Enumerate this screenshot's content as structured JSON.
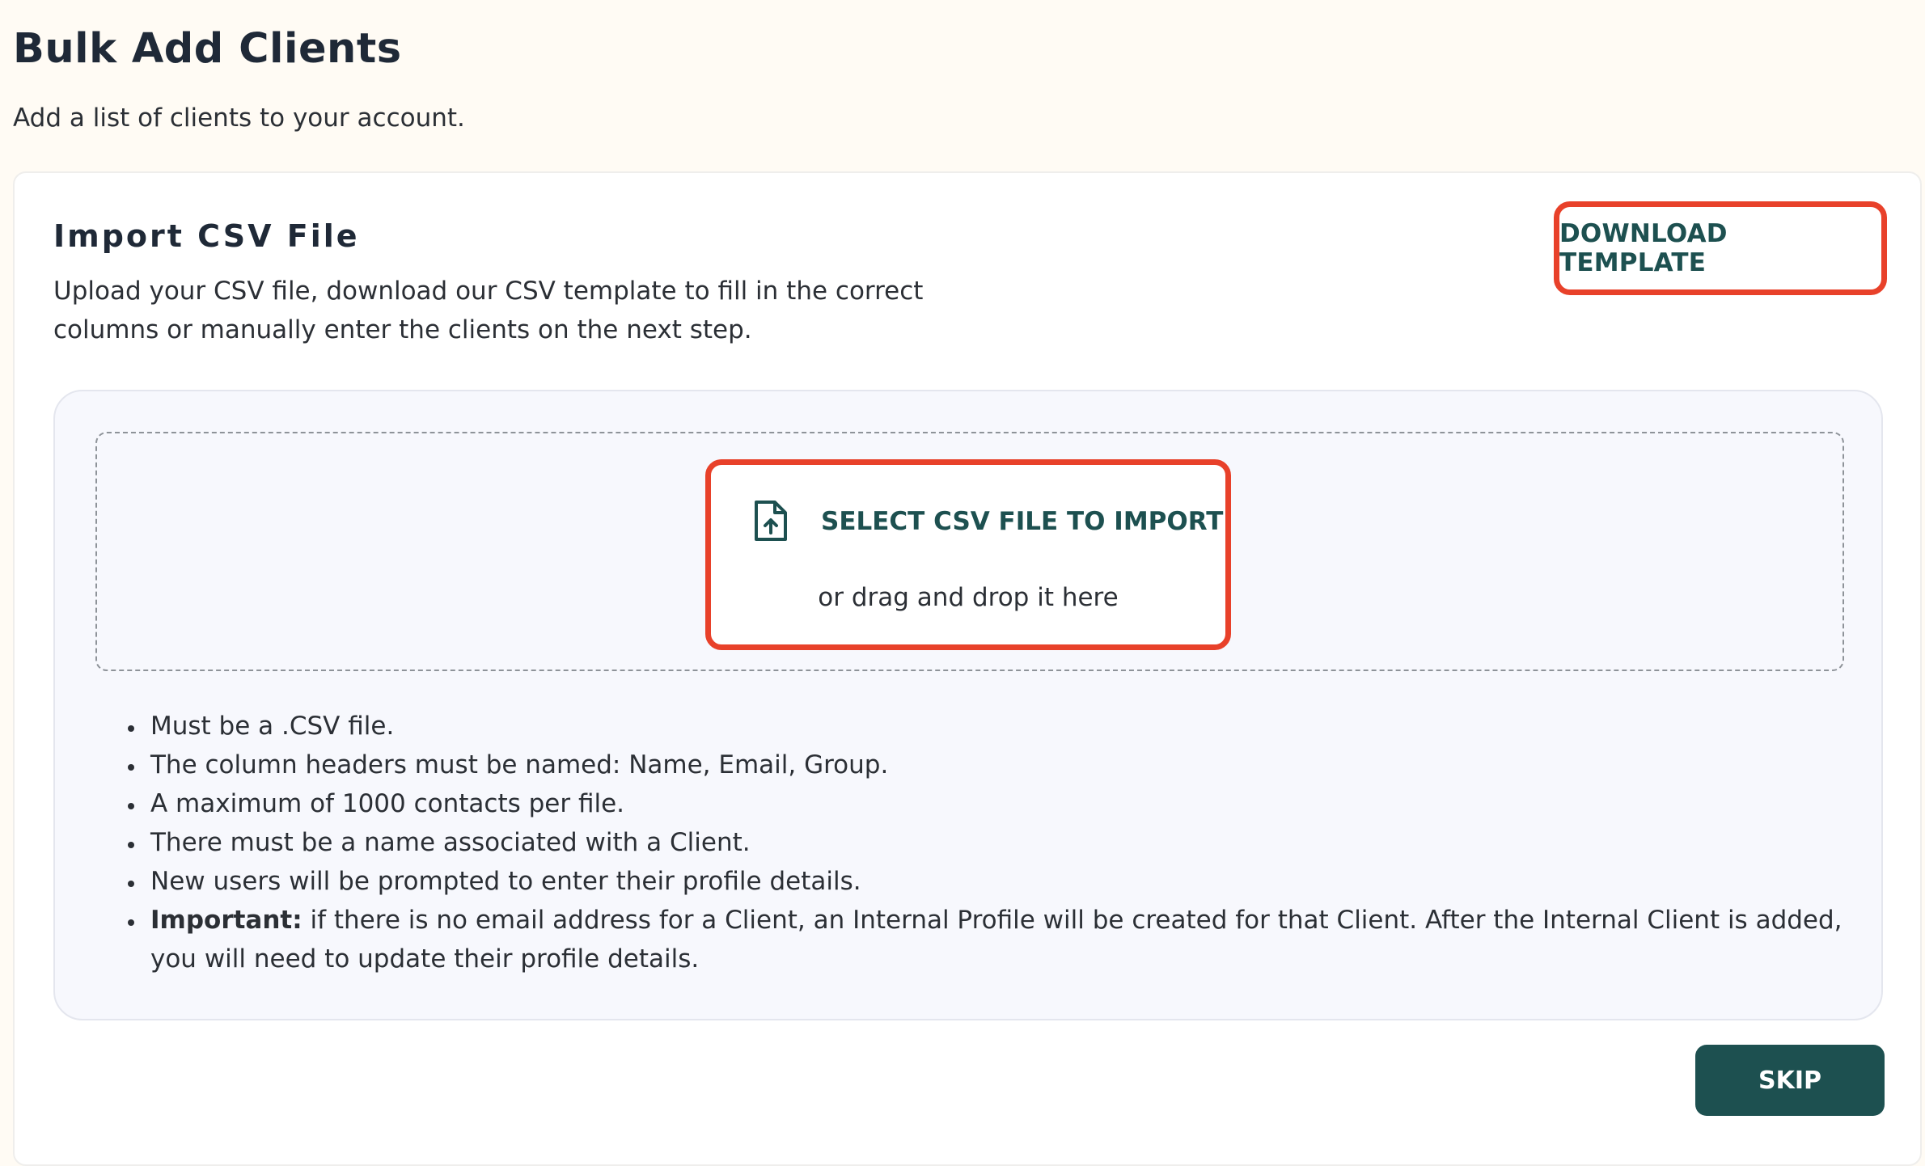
{
  "header": {
    "title": "Bulk Add Clients",
    "subtitle": "Add a list of clients to your account."
  },
  "card": {
    "title": "Import CSV File",
    "description": "Upload your CSV file, download our CSV template to fill in the correct columns or manually enter the clients on the next step.",
    "download_button": "DOWNLOAD TEMPLATE"
  },
  "upload": {
    "select_label": "SELECT CSV FILE TO IMPORT",
    "drag_label": "or drag and drop it here",
    "icon": "file-upload-icon"
  },
  "rules": [
    "Must be a .CSV file.",
    "The column headers must be named: Name, Email, Group.",
    "A maximum of 1000 contacts per file.",
    "There must be a name associated with a Client.",
    "New users will be prompted to enter their profile details."
  ],
  "important_rule": {
    "label": "Important:",
    "text": " if there is no email address for a Client, an Internal Profile will be created for that Client. After the Internal Client is added, you will need to update their profile details."
  },
  "footer": {
    "skip_button": "SKIP"
  },
  "colors": {
    "accent": "#1d5050",
    "highlight": "#e8412a",
    "page_background": "#fffbf4",
    "panel_background": "#f7f8fd"
  }
}
